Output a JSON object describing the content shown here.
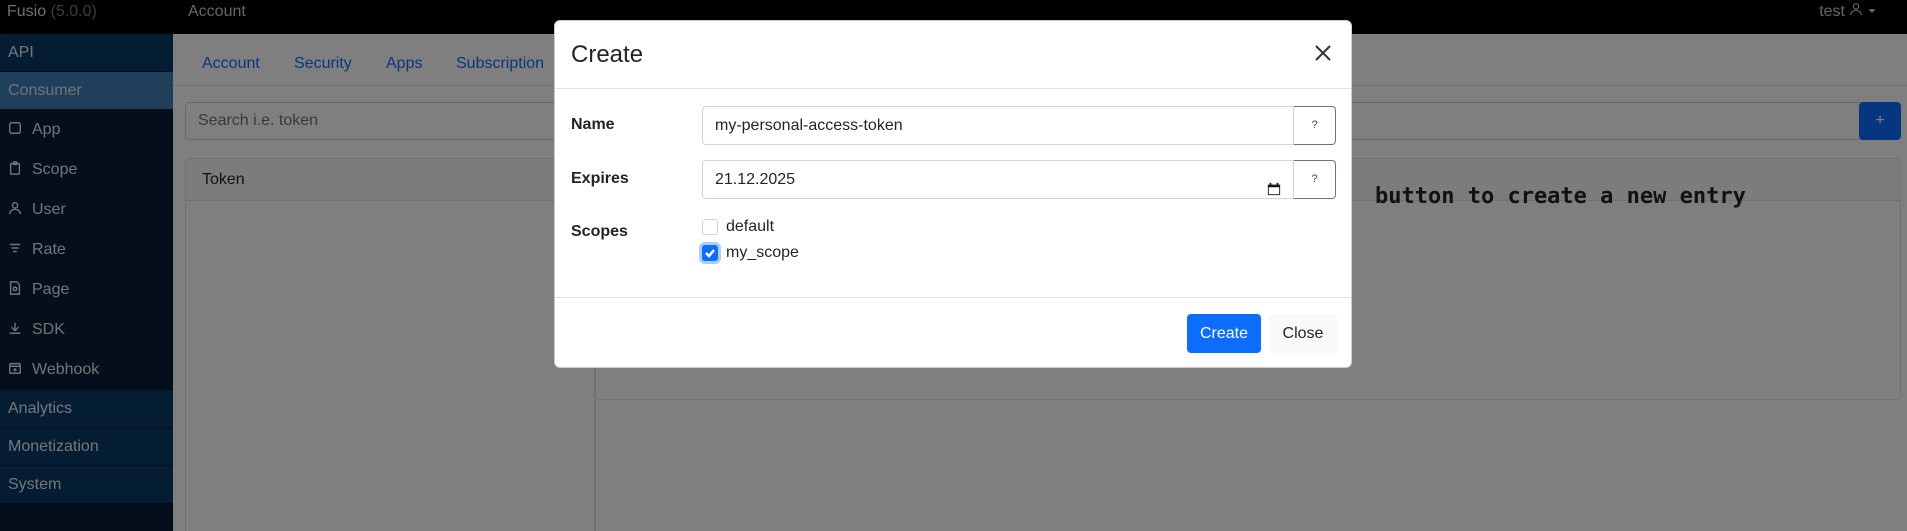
{
  "topbar": {
    "brand": "Fusio",
    "version": "(5.0.0)",
    "section_title": "Account",
    "user": "test"
  },
  "sidebar": {
    "sections": [
      {
        "label": "API"
      },
      {
        "label": "Consumer"
      }
    ],
    "items": [
      {
        "label": "App",
        "icon": "square-icon"
      },
      {
        "label": "Scope",
        "icon": "clipboard-icon"
      },
      {
        "label": "User",
        "icon": "user-icon"
      },
      {
        "label": "Rate",
        "icon": "filter-icon"
      },
      {
        "label": "Page",
        "icon": "page-icon"
      },
      {
        "label": "SDK",
        "icon": "download-icon"
      },
      {
        "label": "Webhook",
        "icon": "webhook-icon"
      }
    ],
    "bottom_sections": [
      {
        "label": "Analytics"
      },
      {
        "label": "Monetization"
      },
      {
        "label": "System"
      }
    ]
  },
  "main": {
    "tabs": [
      {
        "label": "Account"
      },
      {
        "label": "Security"
      },
      {
        "label": "Apps"
      },
      {
        "label": "Subscription"
      }
    ],
    "search_placeholder": "Search i.e. token",
    "add_label": "+",
    "token_header": "Token",
    "empty_message": "button to create a new entry"
  },
  "modal": {
    "title": "Create",
    "fields": {
      "name_label": "Name",
      "name_value": "my-personal-access-token",
      "expires_label": "Expires",
      "expires_value": "21.12.2025",
      "scopes_label": "Scopes",
      "help_label": "?"
    },
    "scopes": [
      {
        "label": "default",
        "checked": false
      },
      {
        "label": "my_scope",
        "checked": true
      }
    ],
    "buttons": {
      "create": "Create",
      "close": "Close"
    }
  },
  "colors": {
    "primary": "#0d6efd",
    "sidebar_bg": "#0b1f36",
    "sidebar_section": "#0a3a67",
    "sidebar_active": "#3e7fb6"
  }
}
